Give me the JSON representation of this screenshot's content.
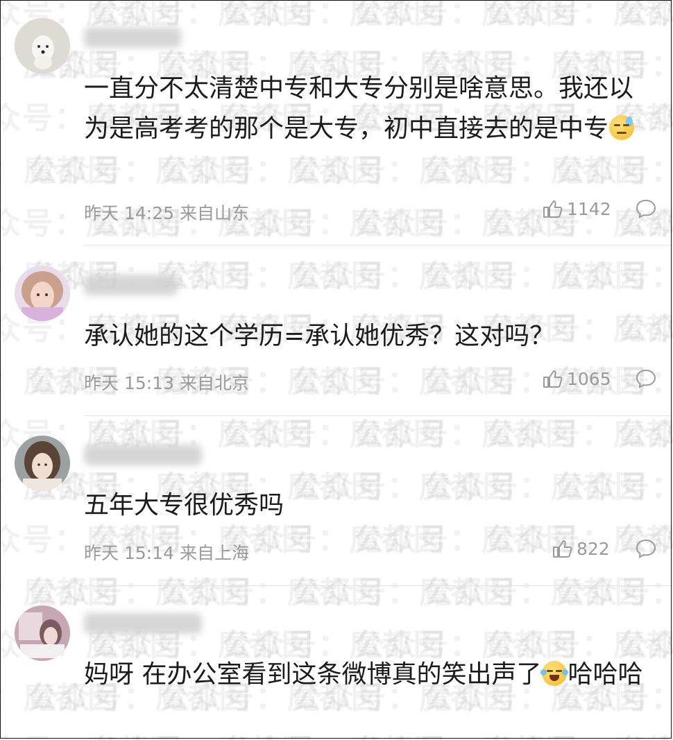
{
  "watermark": {
    "text": "公众号：魔都囡"
  },
  "comments": [
    {
      "content": "一直分不太清楚中专和大专分别是啥意思。我还以为是高考考的那个是大专，初中直接去的是中专",
      "emoji": "downcast-sweat-emoji",
      "time": "昨天 14:25 来自山东",
      "likes": "1142"
    },
    {
      "content": "承认她的这个学历=承认她优秀？这对吗？",
      "time": "昨天 15:13 来自北京",
      "likes": "1065"
    },
    {
      "content": "五年大专很优秀吗",
      "time": "昨天 15:14 来自上海",
      "likes": "822"
    },
    {
      "content_before": "妈呀 在办公室看到这条微博真的笑出声了",
      "emoji": "tears-of-joy-emoji",
      "content_after": "哈哈哈"
    }
  ],
  "colors": {
    "meta_text": "#9a9a9a",
    "divider": "#e4e4e4",
    "content_text": "#1b1b1b"
  }
}
